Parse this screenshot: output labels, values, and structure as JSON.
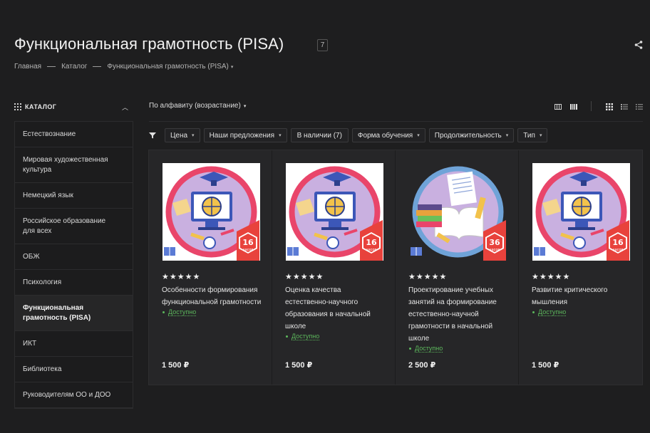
{
  "header": {
    "title": "Функциональная грамотность (PISA)",
    "count": "7"
  },
  "breadcrumb": [
    "Главная",
    "Каталог",
    "Функциональная грамотность (PISA)"
  ],
  "sidebar": {
    "heading": "КАТАЛОГ",
    "items": [
      {
        "label": "Естествознание"
      },
      {
        "label": "Мировая художественная культура"
      },
      {
        "label": "Немецкий язык"
      },
      {
        "label": "Российское образование для всех"
      },
      {
        "label": "ОБЖ"
      },
      {
        "label": "Психология"
      },
      {
        "label": "Функциональная грамотность (PISA)",
        "active": true
      },
      {
        "label": "ИКТ"
      },
      {
        "label": "Библиотека"
      },
      {
        "label": "Руководителям ОО и ДОО"
      }
    ]
  },
  "toolbar": {
    "sort_label": "По алфавиту (возрастание)"
  },
  "filters": [
    "Цена",
    "Наши предложения",
    "В наличии (7)",
    "Форма обучения",
    "Продолжительность",
    "Тип"
  ],
  "products": [
    {
      "stars": "★★★★★",
      "title": "Особенности формирования функциональной грамотности",
      "availability": "Доступно",
      "price": "1 500 ₽",
      "badge_num": "16",
      "badge_unit": "часов",
      "image": "computer-icon"
    },
    {
      "stars": "★★★★★",
      "title": "Оценка качества естественно-научного образования в начальной школе",
      "availability": "Доступно",
      "price": "1 500 ₽",
      "badge_num": "16",
      "badge_unit": "часов",
      "image": "computer-icon"
    },
    {
      "stars": "★★★★★",
      "title": "Проектирование учебных занятий на формирование естественно-научной грамотности в начальной школе",
      "availability": "Доступно",
      "price": "2 500 ₽",
      "badge_num": "36",
      "badge_unit": "часов",
      "image": "books-icon"
    },
    {
      "stars": "★★★★★",
      "title": "Развитие критического мышления",
      "availability": "Доступно",
      "price": "1 500 ₽",
      "badge_num": "16",
      "badge_unit": "часов",
      "image": "computer-icon"
    }
  ],
  "colors": {
    "background": "#1e1e1f",
    "card": "#262628",
    "available": "#5cb85c",
    "badge": "#e8423c"
  }
}
